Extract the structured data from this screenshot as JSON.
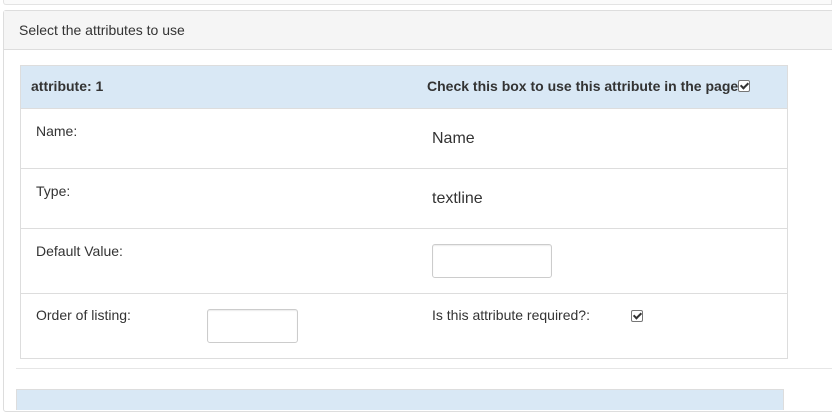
{
  "panel": {
    "title": "Select the attributes to use"
  },
  "attribute": {
    "header_label": "attribute: 1",
    "use_checkbox_label": "Check this box to use this attribute in the page",
    "use_checked": true,
    "name_label": "Name:",
    "name_value": "Name",
    "type_label": "Type:",
    "type_value": "textline",
    "default_label": "Default Value:",
    "default_value": "",
    "order_label": "Order of listing:",
    "order_value": "",
    "required_label": "Is this attribute required?:",
    "required_checked": true
  },
  "colors": {
    "header_bg": "#d9e8f5",
    "panel_heading_bg": "#f5f5f5",
    "border": "#dddddd"
  }
}
